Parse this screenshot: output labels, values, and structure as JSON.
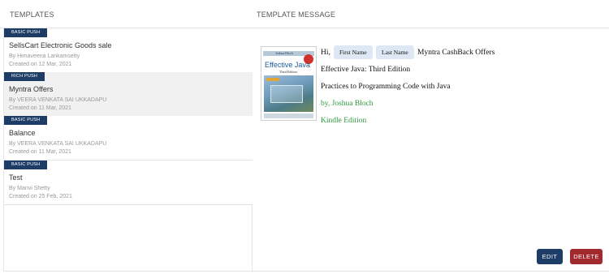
{
  "header": {
    "templates_label": "TEMPLATES",
    "message_label": "TEMPLATE MESSAGE"
  },
  "templates": [
    {
      "badge": "BASIC PUSH",
      "name": "SellsCart Electronic Goods sale",
      "by": "By Himaveena Lankamsetty",
      "created": "Created on 12 Mar, 2021"
    },
    {
      "badge": "RICH PUSH",
      "name": "Myntra Offers",
      "by": "By VEERA VENKATA SAI UKKADAPU",
      "created": "Created on 11 Mar, 2021"
    },
    {
      "badge": "BASIC PUSH",
      "name": "Balance",
      "by": "By VEERA VENKATA SAI UKKADAPU",
      "created": "Created on 11 Mar, 2021"
    },
    {
      "badge": "BASIC PUSH",
      "name": "Test",
      "by": "By Manvi Shetty",
      "created": "Created on 25 Feb, 2021"
    }
  ],
  "message": {
    "greeting": "Hi,",
    "first_name_chip": "First Name",
    "last_name_chip": "Last Name",
    "headline": "Myntra CashBack Offers",
    "line2": "Effective Java: Third Edition",
    "line3": "Practices to Programming Code with Java",
    "line4": "by, Joshua Bloch",
    "line5": "Kindle Edition",
    "image": {
      "author": "Joshua Bloch",
      "title": "Effective Java",
      "subtitle": "Third Edition"
    }
  },
  "actions": {
    "edit_label": "EDIT",
    "delete_label": "DELETE"
  },
  "colors": {
    "badge_bg": "#1d3d66",
    "edit_bg": "#1d3d66",
    "delete_bg": "#a12a2e",
    "chip_bg": "#dde8f4",
    "link_green": "#2e9a3c",
    "selected_row_bg": "#f1f1f1"
  }
}
